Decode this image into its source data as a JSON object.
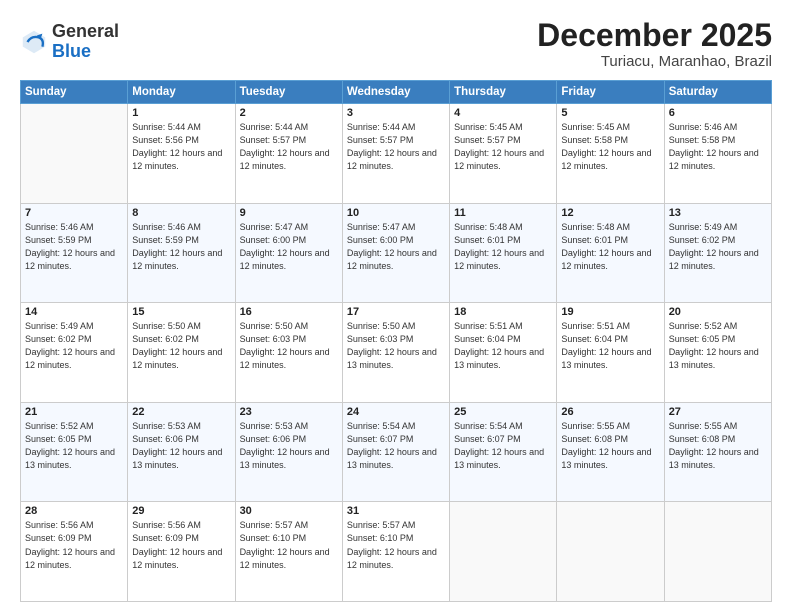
{
  "header": {
    "logo_general": "General",
    "logo_blue": "Blue",
    "main_title": "December 2025",
    "subtitle": "Turiacu, Maranhao, Brazil"
  },
  "calendar": {
    "days_of_week": [
      "Sunday",
      "Monday",
      "Tuesday",
      "Wednesday",
      "Thursday",
      "Friday",
      "Saturday"
    ],
    "weeks": [
      [
        {
          "day": "",
          "empty": true
        },
        {
          "day": "1",
          "sunrise": "Sunrise: 5:44 AM",
          "sunset": "Sunset: 5:56 PM",
          "daylight": "Daylight: 12 hours and 12 minutes."
        },
        {
          "day": "2",
          "sunrise": "Sunrise: 5:44 AM",
          "sunset": "Sunset: 5:57 PM",
          "daylight": "Daylight: 12 hours and 12 minutes."
        },
        {
          "day": "3",
          "sunrise": "Sunrise: 5:44 AM",
          "sunset": "Sunset: 5:57 PM",
          "daylight": "Daylight: 12 hours and 12 minutes."
        },
        {
          "day": "4",
          "sunrise": "Sunrise: 5:45 AM",
          "sunset": "Sunset: 5:57 PM",
          "daylight": "Daylight: 12 hours and 12 minutes."
        },
        {
          "day": "5",
          "sunrise": "Sunrise: 5:45 AM",
          "sunset": "Sunset: 5:58 PM",
          "daylight": "Daylight: 12 hours and 12 minutes."
        },
        {
          "day": "6",
          "sunrise": "Sunrise: 5:46 AM",
          "sunset": "Sunset: 5:58 PM",
          "daylight": "Daylight: 12 hours and 12 minutes."
        }
      ],
      [
        {
          "day": "7",
          "sunrise": "Sunrise: 5:46 AM",
          "sunset": "Sunset: 5:59 PM",
          "daylight": "Daylight: 12 hours and 12 minutes."
        },
        {
          "day": "8",
          "sunrise": "Sunrise: 5:46 AM",
          "sunset": "Sunset: 5:59 PM",
          "daylight": "Daylight: 12 hours and 12 minutes."
        },
        {
          "day": "9",
          "sunrise": "Sunrise: 5:47 AM",
          "sunset": "Sunset: 6:00 PM",
          "daylight": "Daylight: 12 hours and 12 minutes."
        },
        {
          "day": "10",
          "sunrise": "Sunrise: 5:47 AM",
          "sunset": "Sunset: 6:00 PM",
          "daylight": "Daylight: 12 hours and 12 minutes."
        },
        {
          "day": "11",
          "sunrise": "Sunrise: 5:48 AM",
          "sunset": "Sunset: 6:01 PM",
          "daylight": "Daylight: 12 hours and 12 minutes."
        },
        {
          "day": "12",
          "sunrise": "Sunrise: 5:48 AM",
          "sunset": "Sunset: 6:01 PM",
          "daylight": "Daylight: 12 hours and 12 minutes."
        },
        {
          "day": "13",
          "sunrise": "Sunrise: 5:49 AM",
          "sunset": "Sunset: 6:02 PM",
          "daylight": "Daylight: 12 hours and 12 minutes."
        }
      ],
      [
        {
          "day": "14",
          "sunrise": "Sunrise: 5:49 AM",
          "sunset": "Sunset: 6:02 PM",
          "daylight": "Daylight: 12 hours and 12 minutes."
        },
        {
          "day": "15",
          "sunrise": "Sunrise: 5:50 AM",
          "sunset": "Sunset: 6:02 PM",
          "daylight": "Daylight: 12 hours and 12 minutes."
        },
        {
          "day": "16",
          "sunrise": "Sunrise: 5:50 AM",
          "sunset": "Sunset: 6:03 PM",
          "daylight": "Daylight: 12 hours and 12 minutes."
        },
        {
          "day": "17",
          "sunrise": "Sunrise: 5:50 AM",
          "sunset": "Sunset: 6:03 PM",
          "daylight": "Daylight: 12 hours and 13 minutes."
        },
        {
          "day": "18",
          "sunrise": "Sunrise: 5:51 AM",
          "sunset": "Sunset: 6:04 PM",
          "daylight": "Daylight: 12 hours and 13 minutes."
        },
        {
          "day": "19",
          "sunrise": "Sunrise: 5:51 AM",
          "sunset": "Sunset: 6:04 PM",
          "daylight": "Daylight: 12 hours and 13 minutes."
        },
        {
          "day": "20",
          "sunrise": "Sunrise: 5:52 AM",
          "sunset": "Sunset: 6:05 PM",
          "daylight": "Daylight: 12 hours and 13 minutes."
        }
      ],
      [
        {
          "day": "21",
          "sunrise": "Sunrise: 5:52 AM",
          "sunset": "Sunset: 6:05 PM",
          "daylight": "Daylight: 12 hours and 13 minutes."
        },
        {
          "day": "22",
          "sunrise": "Sunrise: 5:53 AM",
          "sunset": "Sunset: 6:06 PM",
          "daylight": "Daylight: 12 hours and 13 minutes."
        },
        {
          "day": "23",
          "sunrise": "Sunrise: 5:53 AM",
          "sunset": "Sunset: 6:06 PM",
          "daylight": "Daylight: 12 hours and 13 minutes."
        },
        {
          "day": "24",
          "sunrise": "Sunrise: 5:54 AM",
          "sunset": "Sunset: 6:07 PM",
          "daylight": "Daylight: 12 hours and 13 minutes."
        },
        {
          "day": "25",
          "sunrise": "Sunrise: 5:54 AM",
          "sunset": "Sunset: 6:07 PM",
          "daylight": "Daylight: 12 hours and 13 minutes."
        },
        {
          "day": "26",
          "sunrise": "Sunrise: 5:55 AM",
          "sunset": "Sunset: 6:08 PM",
          "daylight": "Daylight: 12 hours and 13 minutes."
        },
        {
          "day": "27",
          "sunrise": "Sunrise: 5:55 AM",
          "sunset": "Sunset: 6:08 PM",
          "daylight": "Daylight: 12 hours and 13 minutes."
        }
      ],
      [
        {
          "day": "28",
          "sunrise": "Sunrise: 5:56 AM",
          "sunset": "Sunset: 6:09 PM",
          "daylight": "Daylight: 12 hours and 12 minutes."
        },
        {
          "day": "29",
          "sunrise": "Sunrise: 5:56 AM",
          "sunset": "Sunset: 6:09 PM",
          "daylight": "Daylight: 12 hours and 12 minutes."
        },
        {
          "day": "30",
          "sunrise": "Sunrise: 5:57 AM",
          "sunset": "Sunset: 6:10 PM",
          "daylight": "Daylight: 12 hours and 12 minutes."
        },
        {
          "day": "31",
          "sunrise": "Sunrise: 5:57 AM",
          "sunset": "Sunset: 6:10 PM",
          "daylight": "Daylight: 12 hours and 12 minutes."
        },
        {
          "day": "",
          "empty": true
        },
        {
          "day": "",
          "empty": true
        },
        {
          "day": "",
          "empty": true
        }
      ]
    ]
  }
}
